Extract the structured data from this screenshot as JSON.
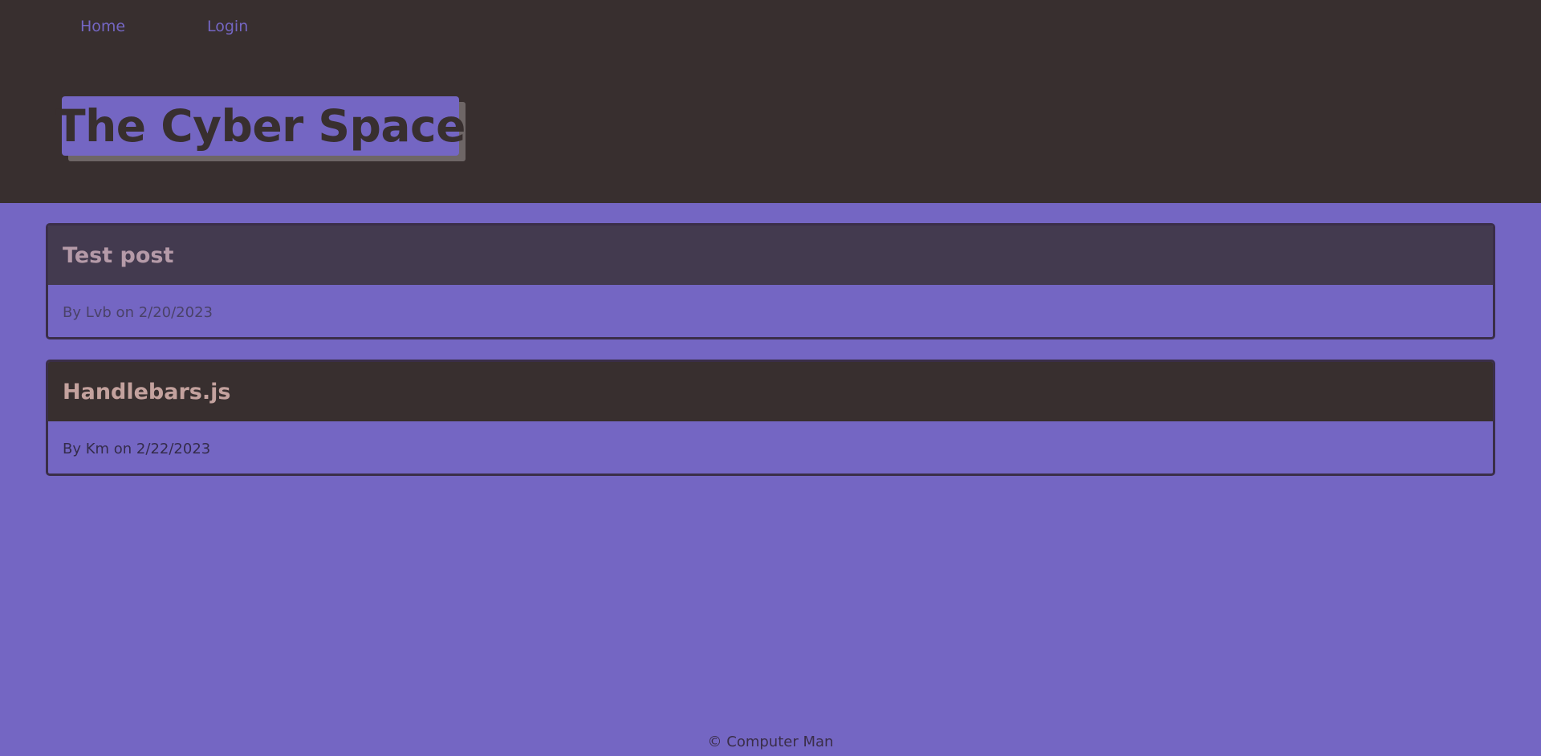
{
  "nav": {
    "items": [
      {
        "label": "Home"
      },
      {
        "label": "Login"
      }
    ]
  },
  "header": {
    "title": "The Cyber Space"
  },
  "posts": [
    {
      "title": "Test post",
      "meta": "By Lvb on 2/20/2023"
    },
    {
      "title": "Handlebars.js",
      "meta": "By Km on 2/22/2023"
    }
  ],
  "footer": {
    "text": "© Computer Man"
  },
  "colors": {
    "header_bg": "#382f2f",
    "page_bg": "#7466c3",
    "accent": "#7466c3",
    "post_border": "#3a2e48"
  }
}
